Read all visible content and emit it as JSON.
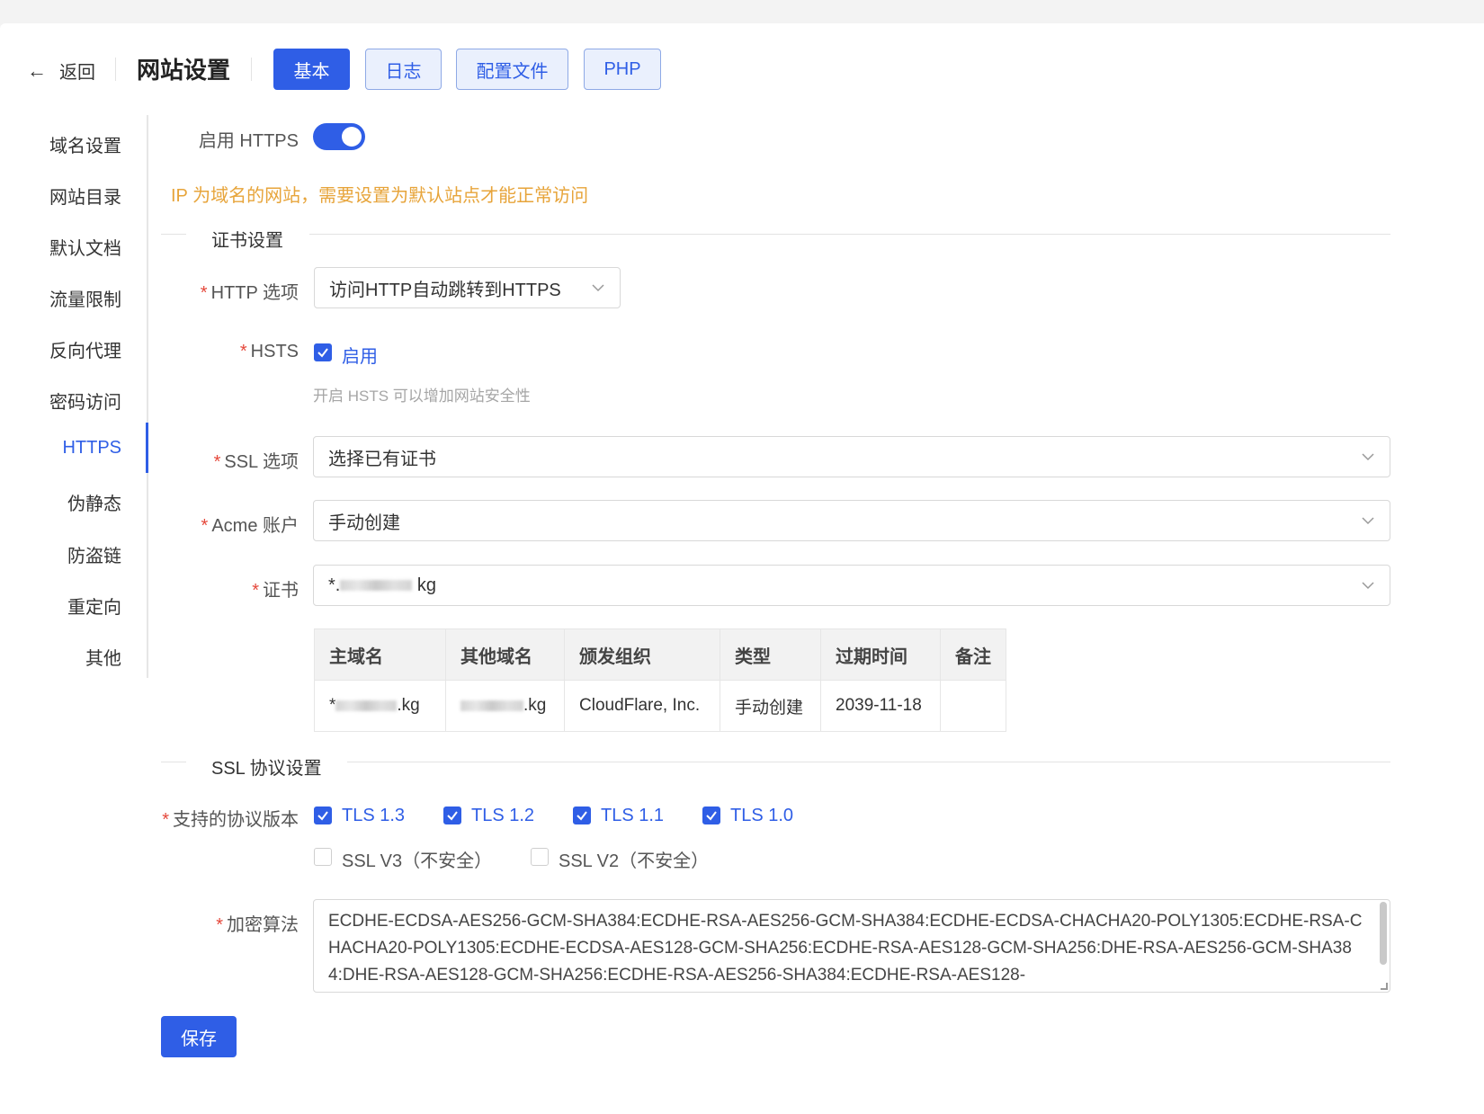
{
  "header": {
    "back_label": "返回",
    "title": "网站设置",
    "tabs": [
      {
        "label": "基本",
        "active": true
      },
      {
        "label": "日志",
        "active": false
      },
      {
        "label": "配置文件",
        "active": false
      },
      {
        "label": "PHP",
        "active": false
      }
    ]
  },
  "sidenav": {
    "items": [
      {
        "label": "域名设置"
      },
      {
        "label": "网站目录"
      },
      {
        "label": "默认文档"
      },
      {
        "label": "流量限制"
      },
      {
        "label": "反向代理"
      },
      {
        "label": "密码访问"
      },
      {
        "label": "HTTPS",
        "active": true
      },
      {
        "label": "伪静态"
      },
      {
        "label": "防盗链"
      },
      {
        "label": "重定向"
      },
      {
        "label": "其他"
      }
    ]
  },
  "form": {
    "enable_https": {
      "label": "启用 HTTPS",
      "value": true
    },
    "warning": "IP 为域名的网站，需要设置为默认站点才能正常访问",
    "cert_section_title": "证书设置",
    "http_option": {
      "label": "HTTP 选项",
      "value": "访问HTTP自动跳转到HTTPS"
    },
    "hsts": {
      "label": "HSTS",
      "checkbox_label": "启用",
      "checked": true,
      "hint": "开启 HSTS 可以增加网站安全性"
    },
    "ssl_option": {
      "label": "SSL 选项",
      "value": "选择已有证书"
    },
    "acme_account": {
      "label": "Acme 账户",
      "value": "手动创建"
    },
    "certificate": {
      "label": "证书",
      "value_prefix": "*.",
      "value_suffix": "kg"
    },
    "cert_table": {
      "headers": [
        "主域名",
        "其他域名",
        "颁发组织",
        "类型",
        "过期时间",
        "备注"
      ],
      "row": {
        "main_domain_prefix": "*",
        "main_domain_suffix": ".kg",
        "other_domain_suffix": ".kg",
        "issuer": "CloudFlare, Inc.",
        "type": "手动创建",
        "expiry": "2039-11-18",
        "note": ""
      }
    },
    "ssl_section_title": "SSL 协议设置",
    "protocols": {
      "label": "支持的协议版本",
      "items": [
        {
          "label": "TLS 1.3",
          "checked": true
        },
        {
          "label": "TLS 1.2",
          "checked": true
        },
        {
          "label": "TLS 1.1",
          "checked": true
        },
        {
          "label": "TLS 1.0",
          "checked": true
        },
        {
          "label": "SSL V3（不安全）",
          "checked": false
        },
        {
          "label": "SSL V2（不安全）",
          "checked": false
        }
      ]
    },
    "cipher": {
      "label": "加密算法",
      "value": "ECDHE-ECDSA-AES256-GCM-SHA384:ECDHE-RSA-AES256-GCM-SHA384:ECDHE-ECDSA-CHACHA20-POLY1305:ECDHE-RSA-CHACHA20-POLY1305:ECDHE-ECDSA-AES128-GCM-SHA256:ECDHE-RSA-AES128-GCM-SHA256:DHE-RSA-AES256-GCM-SHA384:DHE-RSA-AES128-GCM-SHA256:ECDHE-RSA-AES256-SHA384:ECDHE-RSA-AES128-"
    },
    "save_label": "保存"
  },
  "colors": {
    "accent": "#2f5ee6",
    "warning": "#e7a43a",
    "required": "#e5483b"
  },
  "icons": {
    "back": "arrow-left-icon",
    "select": "chevron-down-icon",
    "checkbox": "check-icon"
  }
}
